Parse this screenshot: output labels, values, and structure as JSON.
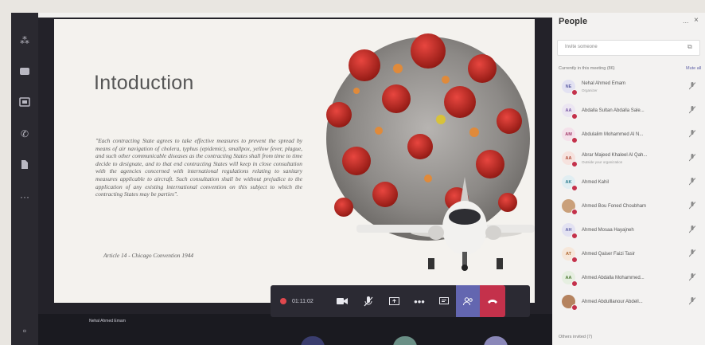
{
  "app_rail": {
    "icons": [
      "teams-logo-icon",
      "chat-icon",
      "calendar-icon",
      "calls-icon",
      "files-icon",
      "more-icon"
    ]
  },
  "slide": {
    "title": "Intoduction",
    "quote": "\"Each contracting State agrees to take effective measures to prevent the spread by means of air navigation of cholera, typhus (epidemic), smallpox, yellow fever, plague, and such other communicable diseases as the contracting States shall from time to time decide to designate, and to that end contracting States will keep in close consultation with the agencies concerned with international regulations relating to sanitary measures applicable to aircraft. Such consultation shall be without prejudice to the application of any existing international convention on this subject to which the contracting States may be parties\".",
    "citation": "Article 14 - Chicago Convention 1944"
  },
  "call_toolbar": {
    "timer": "01:11:02",
    "buttons": [
      "camera-icon",
      "mic-off-icon",
      "share-screen-icon",
      "more-actions-icon",
      "chat-icon",
      "participants-icon",
      "hang-up-icon"
    ]
  },
  "stage": {
    "tile_name": "Nehal Ahmed Emam"
  },
  "people_panel": {
    "title": "People",
    "more": "...",
    "close": "×",
    "search_placeholder": "Invite someone",
    "section_label": "Currently in this meeting (86)",
    "mute_all": "Mute all",
    "participants": [
      {
        "initials": "NE",
        "name": "Nehal Ahmed Emam",
        "subtitle": "Organizer",
        "avatar_color": "#e3e2f2",
        "text_color": "#6264a7"
      },
      {
        "initials": "AA",
        "name": "Abdalla Sultan Abdalla Sale...",
        "subtitle": "",
        "avatar_color": "#ece6f2",
        "text_color": "#7b5aa6"
      },
      {
        "initials": "AM",
        "name": "Abdulalim Mohammed Al N...",
        "subtitle": "",
        "avatar_color": "#f4e1ea",
        "text_color": "#a33d6b"
      },
      {
        "initials": "AA",
        "name": "Abrar Majeed Khaleel Al Qah...",
        "subtitle": "Outside your organization",
        "avatar_color": "#f6e2de",
        "text_color": "#b04a38"
      },
      {
        "initials": "AK",
        "name": "Ahmed Kahil",
        "subtitle": "",
        "avatar_color": "#e1eef2",
        "text_color": "#2a7c8e"
      },
      {
        "initials": "",
        "name": "Ahmed Bou Foned Choubham",
        "subtitle": "",
        "avatar_color": "#caa07a",
        "text_color": "#ffffff"
      },
      {
        "initials": "AH",
        "name": "Ahmed Mosaa Hayajneh",
        "subtitle": "",
        "avatar_color": "#e3e2f2",
        "text_color": "#6264a7"
      },
      {
        "initials": "AT",
        "name": "Ahmed Qaiser Faizi Tasir",
        "subtitle": "",
        "avatar_color": "#f6e7da",
        "text_color": "#b0642b"
      },
      {
        "initials": "AA",
        "name": "Ahmed Abdalla Mohammed...",
        "subtitle": "",
        "avatar_color": "#e6efe1",
        "text_color": "#4d7a35"
      },
      {
        "initials": "",
        "name": "Ahmed Abdulllanour Abdell...",
        "subtitle": "",
        "avatar_color": "#b5835f",
        "text_color": "#ffffff"
      }
    ],
    "others_label": "Others invited (7)"
  },
  "colors": {
    "accent": "#6264a7",
    "hangup": "#c4314b",
    "rail": "#2a2930",
    "panel_bg": "#f3f2f1"
  }
}
